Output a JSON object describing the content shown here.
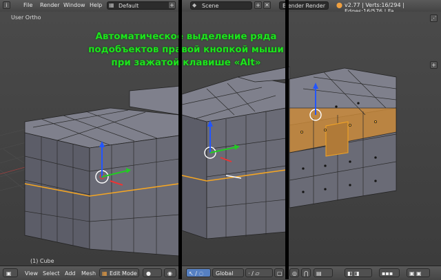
{
  "menu": {
    "file": "File",
    "render": "Render",
    "window": "Window",
    "help": "Help"
  },
  "layout_field": {
    "value": "Default"
  },
  "scene_field": {
    "value": "Scene"
  },
  "engine_field": {
    "value": "Blender Render"
  },
  "stats": {
    "text": "v2.77 | Verts:16/294 | Edges:16/576 | Fa"
  },
  "viewport": {
    "view_label": "User Ortho",
    "object_label": "(1) Cube"
  },
  "caption": {
    "line1": "Автоматическое выделение ряда",
    "line2": "подобъектов правой кнопкой мыши",
    "line3": "при зажатой клавише «Alt»"
  },
  "bottom": {
    "view": "View",
    "select": "Select",
    "add": "Add",
    "mesh": "Mesh",
    "mode": "Edit Mode",
    "orientation": "Global"
  },
  "colors": {
    "highlight": "#f5a623",
    "caption": "#1ee31e",
    "cube_face": "#5b5b66",
    "selected": "#c88a3a"
  }
}
